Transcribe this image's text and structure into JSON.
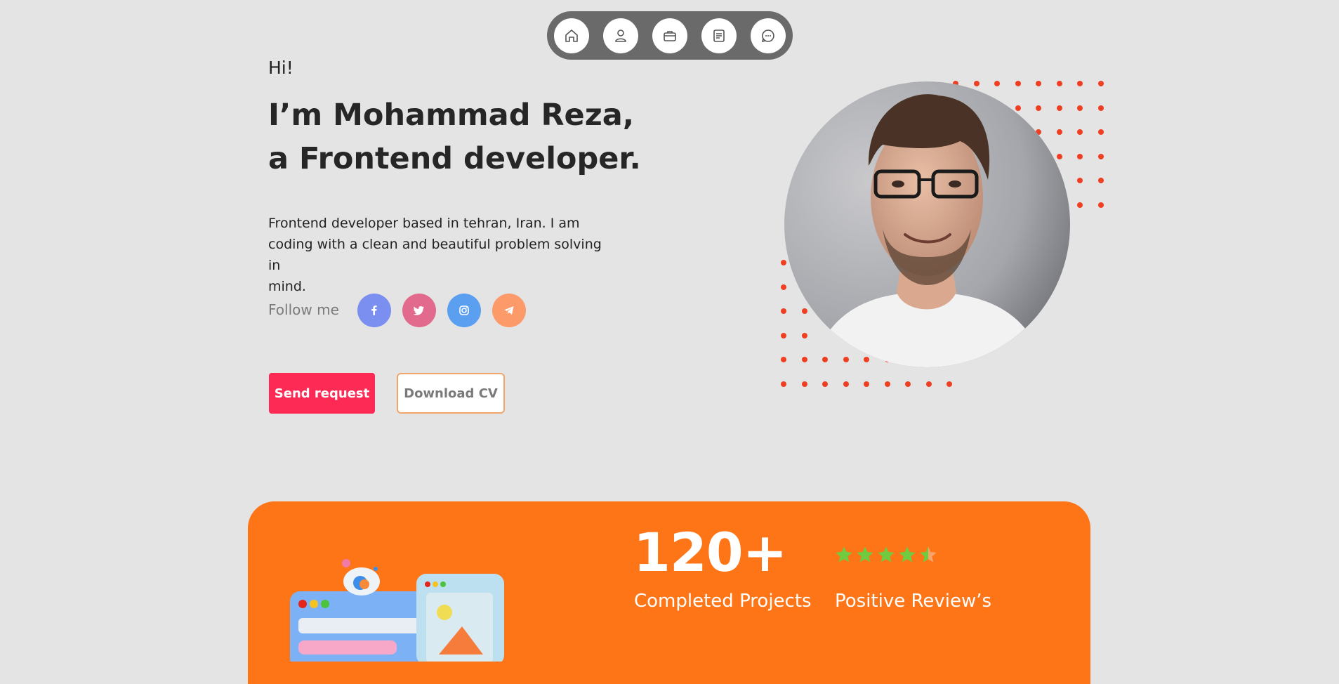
{
  "nav": {
    "items": [
      {
        "icon": "home-icon"
      },
      {
        "icon": "user-icon"
      },
      {
        "icon": "briefcase-icon"
      },
      {
        "icon": "document-icon"
      },
      {
        "icon": "chat-icon"
      }
    ]
  },
  "hero": {
    "greeting": "Hi!",
    "headline_line1": "I’m Mohammad Reza,",
    "headline_line2": "a Frontend developer.",
    "intro_line1": "Frontend developer based in tehran, Iran. I am",
    "intro_line2": "coding with a clean and beautiful problem solving in",
    "intro_line3": "mind.",
    "follow_label": "Follow me",
    "social": [
      {
        "icon": "facebook-icon",
        "color": "#7b8ff0"
      },
      {
        "icon": "twitter-icon",
        "color": "#e26a8d"
      },
      {
        "icon": "instagram-icon",
        "color": "#5b9ff0"
      },
      {
        "icon": "telegram-icon",
        "color": "#fd9a6a"
      }
    ],
    "primary_button": "Send request",
    "secondary_button": "Download CV"
  },
  "stats": {
    "projects_count": "120+",
    "projects_label": "Completed Projects",
    "rating": 4.5,
    "reviews_label": "Positive Review’s"
  },
  "colors": {
    "page_bg": "#e4e4e4",
    "accent_orange": "#fe7517",
    "button_pink": "#fd2a55",
    "dot_red": "#ee3f22",
    "star_green": "#6fcb3f"
  }
}
